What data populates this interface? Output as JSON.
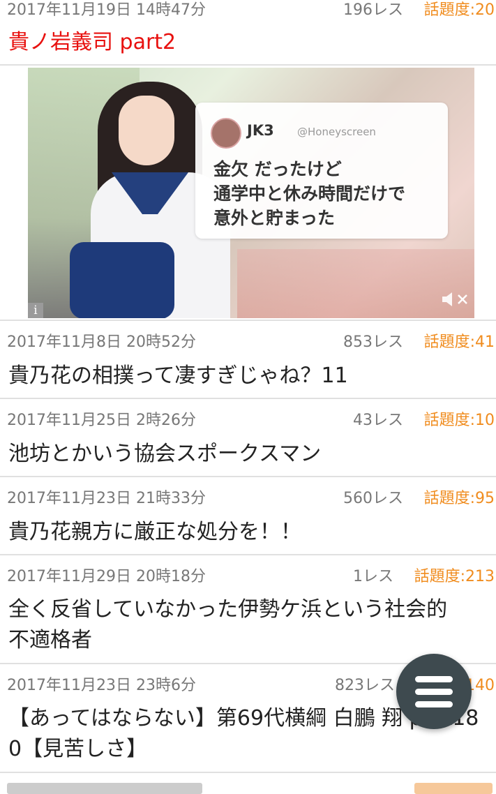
{
  "items": [
    {
      "date": "2017年11月19日 14時47分",
      "res": "196レス",
      "topic": "話題度:20",
      "title": "貴ノ岩義司 part2"
    },
    {
      "date": "2017年11月8日 20時52分",
      "res": "853レス",
      "topic": "話題度:41",
      "title": "貴乃花の相撲って凄すぎじゃね？11"
    },
    {
      "date": "2017年11月25日 2時26分",
      "res": "43レス",
      "topic": "話題度:10",
      "title": "池坊とかいう協会スポークスマン"
    },
    {
      "date": "2017年11月23日 21時33分",
      "res": "560レス",
      "topic": "話題度:95",
      "title": "貴乃花親方に厳正な処分を！！"
    },
    {
      "date": "2017年11月29日 20時18分",
      "res": "1レス",
      "topic": "話題度:213",
      "title_line1": "全く反省していなかった伊勢ケ浜という社会的",
      "title_line2": "不適格者"
    },
    {
      "date": "2017年11月23日 23時6分",
      "res": "823レス",
      "topic": "140",
      "title_line1": "【あってはならない】第69代横綱 白鵬 翔 part18",
      "title_line2": "0【見苦しさ】"
    }
  ],
  "ad": {
    "name": "JK3",
    "handle": "@Honeyscreen",
    "message": "金欠 だったけど\n通学中と休み時間だけで\n意外と貯まった"
  },
  "colors": {
    "topic": "#f08c1e",
    "highlight_title": "#e8110f",
    "fab": "#3e4a4f"
  },
  "icons": {
    "fab": "hamburger-menu-icon",
    "ad_info": "info-icon",
    "ad_mute": "mute-icon"
  }
}
